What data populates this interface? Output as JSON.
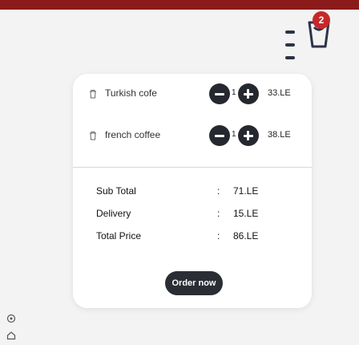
{
  "header": {
    "cart_count": "2"
  },
  "cart": {
    "items": [
      {
        "name": "Turkish cofe",
        "qty": "1",
        "price": "33.LE"
      },
      {
        "name": "french coffee",
        "qty": "1",
        "price": "38.LE"
      }
    ]
  },
  "summary": {
    "subtotal_label": "Sub Total",
    "subtotal_value": "71.LE",
    "delivery_label": "Delivery",
    "delivery_value": "15.LE",
    "total_label": "Total Price",
    "total_value": "86.LE",
    "colon": ":"
  },
  "actions": {
    "order_label": "Order now"
  },
  "colors": {
    "topbar": "#8b1a1a",
    "badge": "#c62828",
    "dark": "#25292f"
  },
  "icons": [
    "menu-icon",
    "cart-icon",
    "trash-icon",
    "minus-icon",
    "plus-icon",
    "settings-icon",
    "home-icon"
  ]
}
